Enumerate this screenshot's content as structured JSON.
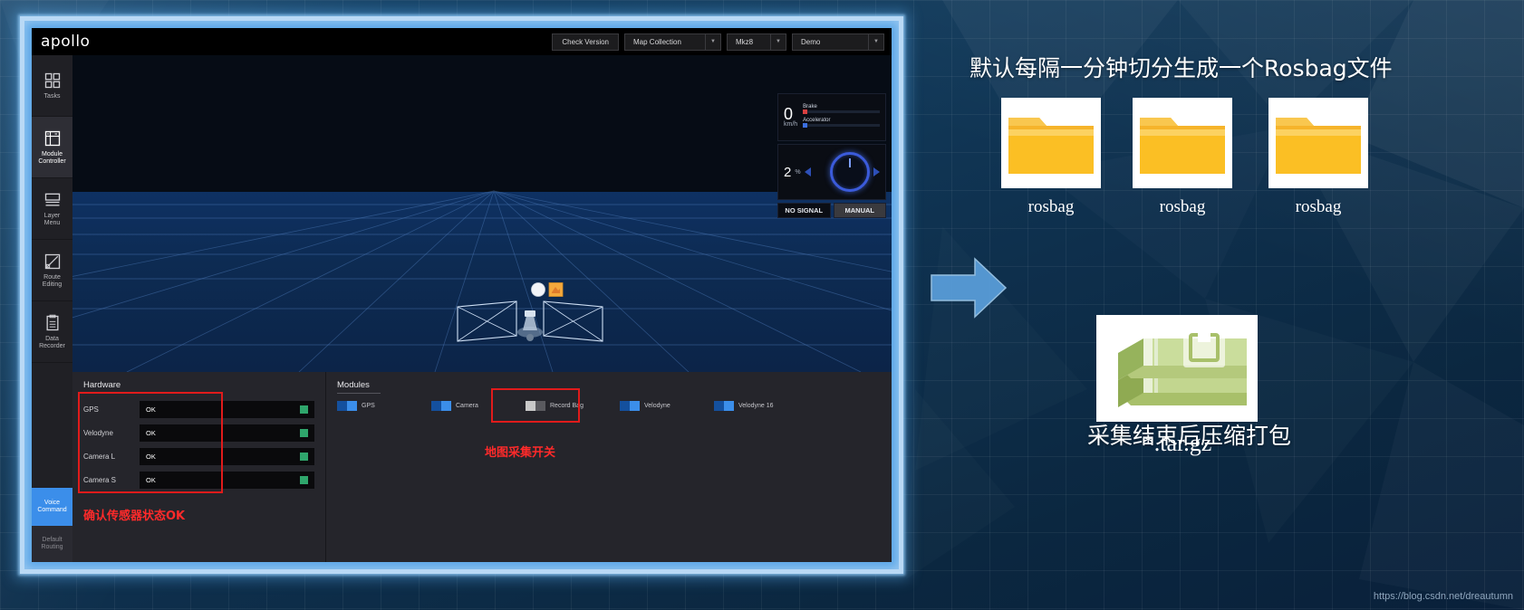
{
  "app": {
    "logo": "apollo",
    "header": {
      "check_version_label": "Check Version",
      "map_collection_label": "Map Collection",
      "vehicle_label": "Mkz8",
      "mode_label": "Demo",
      "chevron": "▼"
    },
    "sidebar": {
      "items": [
        {
          "id": "tasks",
          "label": "Tasks",
          "icon": "grid-icon",
          "active": false
        },
        {
          "id": "module-controller",
          "label": "Module\nController",
          "icon": "sliders-icon",
          "active": true
        },
        {
          "id": "layer-menu",
          "label": "Layer\nMenu",
          "icon": "layers-icon",
          "active": false
        },
        {
          "id": "route-editing",
          "label": "Route\nEditing",
          "icon": "route-icon",
          "active": false
        },
        {
          "id": "data-recorder",
          "label": "Data\nRecorder",
          "icon": "clipboard-icon",
          "active": false
        }
      ],
      "voice_command_label": "Voice\nCommand",
      "default_routing_label": "Default\nRouting"
    },
    "dashboard": {
      "speed_value": "0",
      "speed_unit": "km/h",
      "brake_label": "Brake",
      "accelerator_label": "Accelerator",
      "brake_color": "#d94040",
      "accelerator_color": "#3b6fe0",
      "throttle_value": "2",
      "throttle_unit": "%",
      "signal_status": "NO SIGNAL",
      "drive_mode": "MANUAL"
    },
    "hardware": {
      "title": "Hardware",
      "rows": [
        {
          "name": "GPS",
          "status": "OK",
          "ok": true
        },
        {
          "name": "Velodyne",
          "status": "OK",
          "ok": true
        },
        {
          "name": "Camera L",
          "status": "OK",
          "ok": true
        },
        {
          "name": "Camera S",
          "status": "OK",
          "ok": true
        }
      ],
      "annotation": "确认传感器状态OK"
    },
    "modules": {
      "title": "Modules",
      "items": [
        {
          "name": "GPS",
          "on": true
        },
        {
          "name": "Camera",
          "on": true
        },
        {
          "name": "Record Bag",
          "on": false
        },
        {
          "name": "Velodyne",
          "on": true
        },
        {
          "name": "Velodyne 16",
          "on": true
        }
      ],
      "annotation": "地图采集开关"
    }
  },
  "annotations": {
    "top_heading": "默认每隔一分钟切分生成一个Rosbag文件",
    "mid_heading": "采集结束后压缩打包",
    "folders": [
      {
        "caption": "rosbag"
      },
      {
        "caption": "rosbag"
      },
      {
        "caption": "rosbag"
      }
    ],
    "archive_label": "*.tar.gz",
    "arrow_color": "#5a9fdc"
  },
  "watermark": "https://blog.csdn.net/dreautumn"
}
